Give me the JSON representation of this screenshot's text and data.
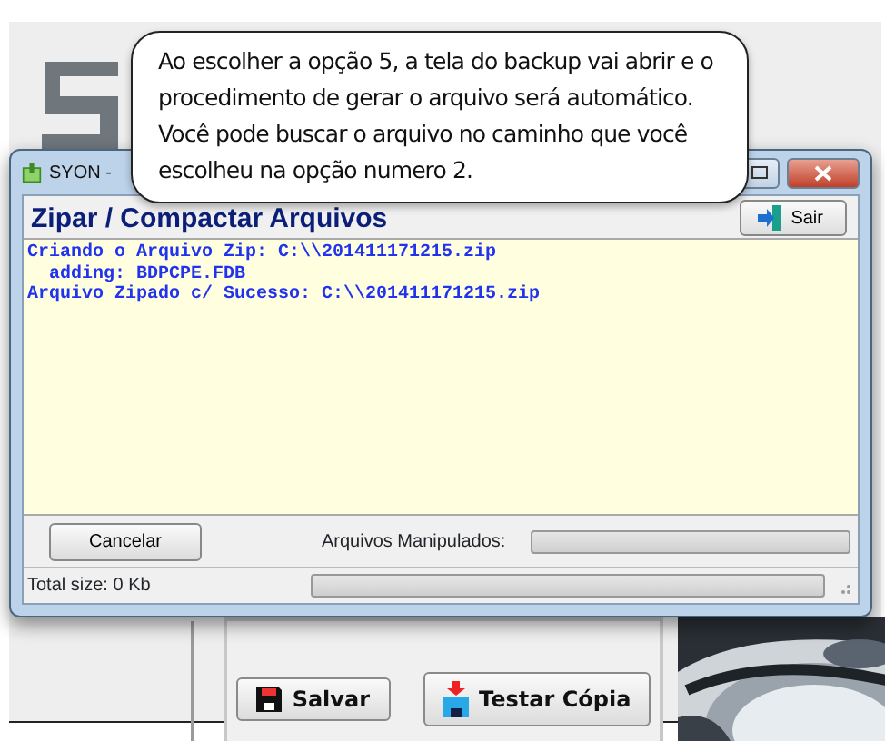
{
  "callout": {
    "lines": [
      "Ao escolher a opção 5, a tela do backup vai abrir e o",
      "procedimento de gerar o arquivo será automático.",
      "Você pode buscar o arquivo no caminho que você",
      "escolheu na opção numero 2."
    ]
  },
  "window": {
    "title": "SYON -"
  },
  "dialog": {
    "heading": "Zipar / Compactar Arquivos",
    "exit_button": "Sair",
    "log": [
      "Criando o Arquivo Zip: C:\\\\201411171215.zip",
      "  adding: BDPCPE.FDB",
      "Arquivo Zipado c/ Sucesso: C:\\\\201411171215.zip"
    ],
    "cancel_button": "Cancelar",
    "files_label": "Arquivos Manipulados:",
    "files_progress": {
      "level": 0
    },
    "status_bar": {
      "text": "Total size: 0 Kb",
      "progress": {
        "level": 0
      }
    }
  },
  "background_app": {
    "buttons": [
      {
        "kind": "save",
        "label": "Salvar"
      },
      {
        "kind": "test",
        "label": "Testar Cópia"
      }
    ]
  }
}
